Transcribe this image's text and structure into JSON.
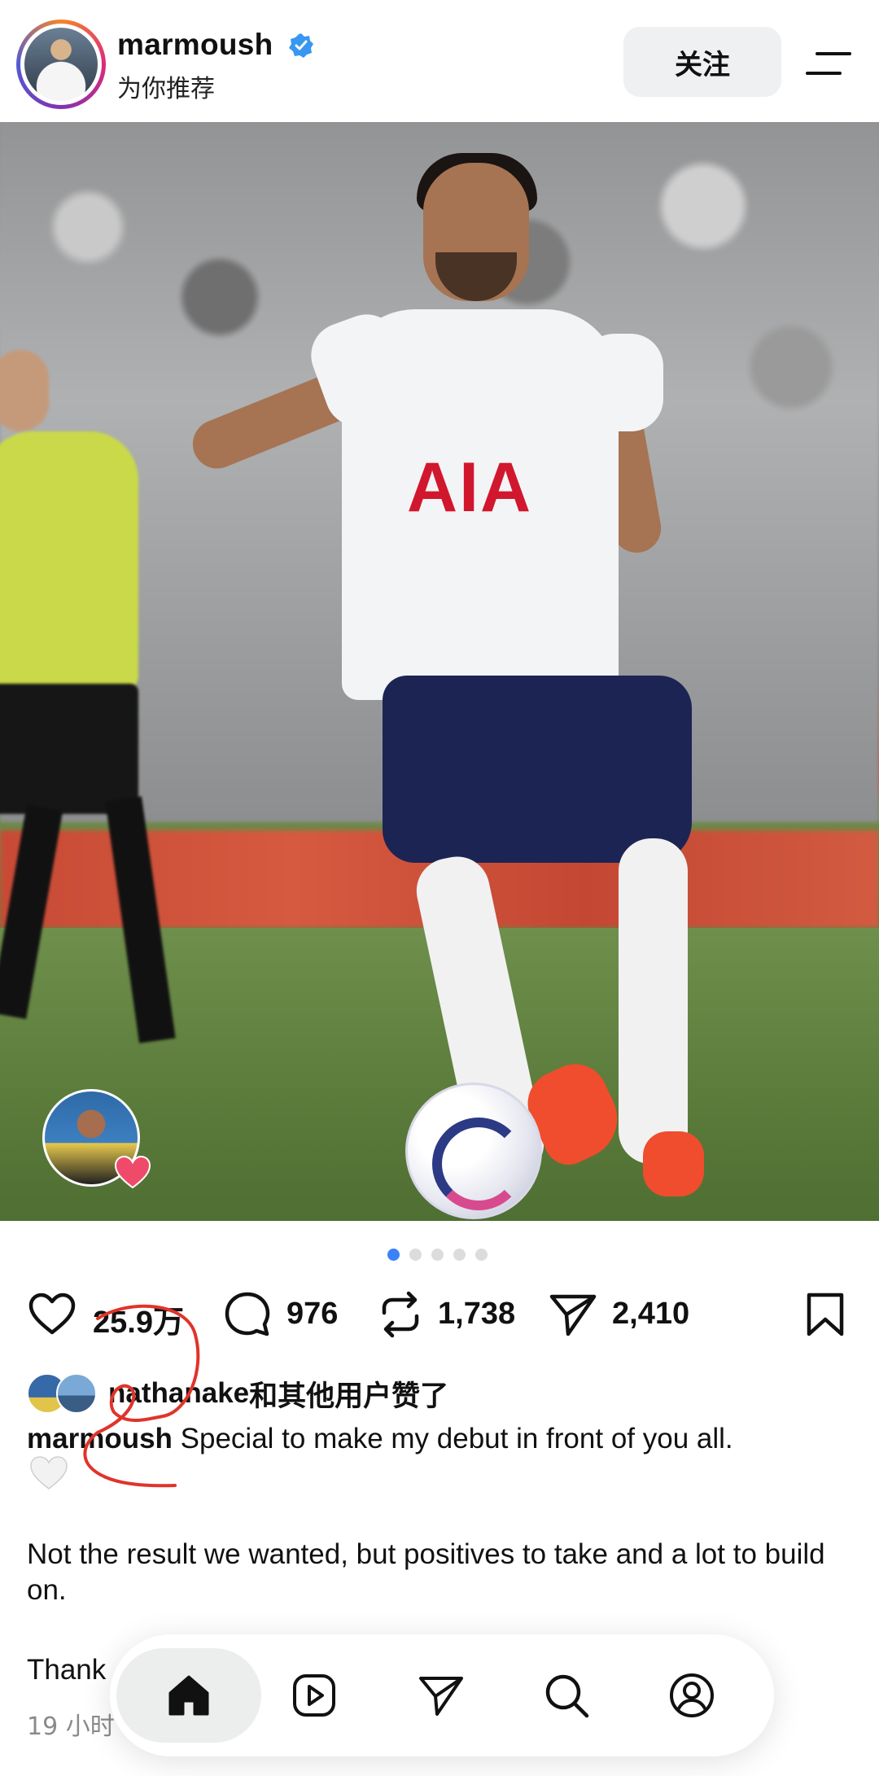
{
  "header": {
    "username": "marmoush",
    "subtitle": "为你推荐",
    "follow_label": "关注"
  },
  "photo": {
    "shirt_sponsor": "AIA",
    "carousel_total": 5,
    "carousel_active": 1
  },
  "actions": {
    "likes": "25.9万",
    "comments": "976",
    "reposts": "1,738",
    "shares": "2,410"
  },
  "liked_by": {
    "user": "nathanake",
    "suffix": "和其他用户赞了"
  },
  "caption": {
    "user": "marmoush",
    "text": " Special to make my debut in front of you all.",
    "paragraph2": "Not the result we wanted, but positives to take and a lot to build on.",
    "paragraph3": "Thank",
    "timestamp": "19 小时"
  },
  "icons": {
    "verified": "verified-badge-icon",
    "menu": "menu-icon",
    "like": "heart-icon",
    "comment": "comment-icon",
    "repost": "repost-icon",
    "share": "send-icon",
    "save": "bookmark-icon",
    "home": "home-icon",
    "reels": "reels-icon",
    "send": "send-icon",
    "search": "search-icon",
    "profile": "profile-icon"
  },
  "colors": {
    "verified": "#3897f0",
    "active_dot": "#3b82f6",
    "annotation": "#e0342a"
  }
}
